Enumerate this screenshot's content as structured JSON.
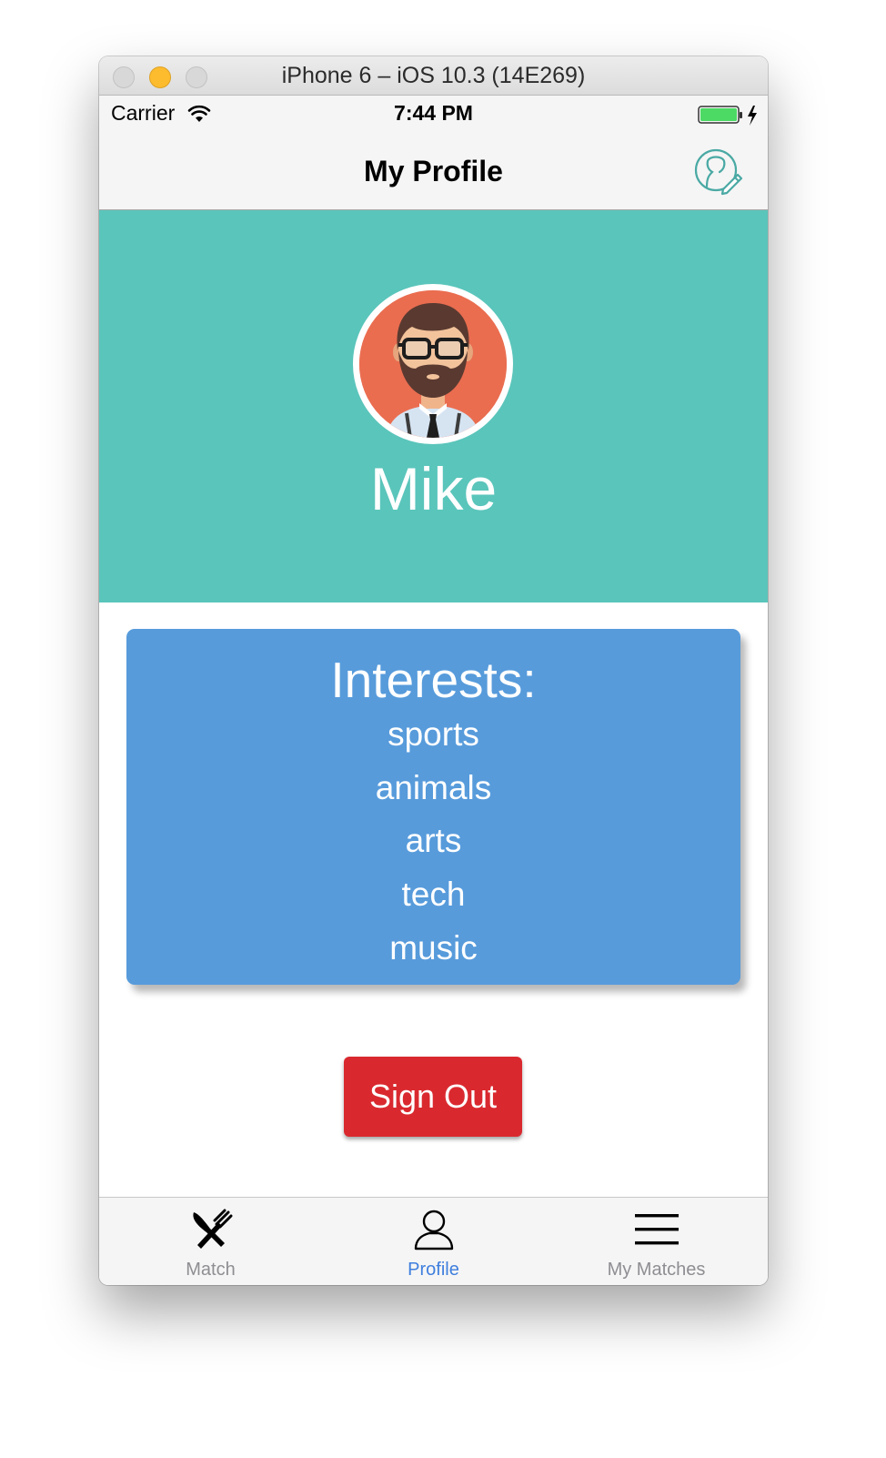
{
  "window": {
    "title": "iPhone 6 – iOS 10.3 (14E269)"
  },
  "status_bar": {
    "carrier": "Carrier",
    "time": "7:44 PM"
  },
  "nav": {
    "title": "My Profile"
  },
  "profile": {
    "name": "Mike"
  },
  "interests": {
    "heading": "Interests:",
    "items": [
      "sports",
      "animals",
      "arts",
      "tech",
      "music"
    ]
  },
  "actions": {
    "sign_out_label": "Sign Out"
  },
  "tabs": [
    {
      "label": "Match",
      "icon": "fork-knife-icon",
      "active": false
    },
    {
      "label": "Profile",
      "icon": "person-icon",
      "active": true
    },
    {
      "label": "My Matches",
      "icon": "menu-lines-icon",
      "active": false
    }
  ],
  "colors": {
    "hero_background": "#5ac5bb",
    "interests_card": "#579bdb",
    "sign_out": "#d9292f",
    "active_tab": "#3f7fde",
    "inactive_tab": "#8e8e93",
    "battery": "#4cd964"
  }
}
